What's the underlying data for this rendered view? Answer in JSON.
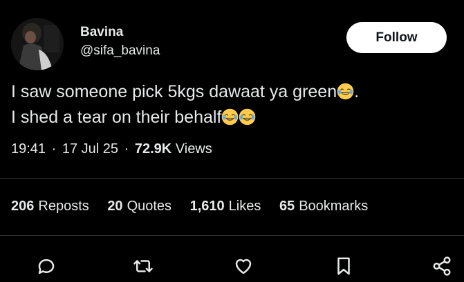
{
  "author": {
    "display_name": "Bavina",
    "handle": "@sifa_bavina"
  },
  "follow_button": {
    "label": "Follow"
  },
  "tweet": {
    "line1": "I saw someone pick 5kgs dawaat ya green",
    "line1_end": ".",
    "line2": "I shed a tear on their behalf",
    "emoji": "face-with-tears-of-joy"
  },
  "meta": {
    "time": "19:41",
    "separator": "·",
    "date": "17 Jul 25",
    "views_count": "72.9K",
    "views_label": "Views"
  },
  "stats": {
    "reposts": {
      "count": "206",
      "label": "Reposts"
    },
    "quotes": {
      "count": "20",
      "label": "Quotes"
    },
    "likes": {
      "count": "1,610",
      "label": "Likes"
    },
    "bookmarks": {
      "count": "65",
      "label": "Bookmarks"
    }
  },
  "actions": [
    "reply-icon",
    "repost-icon",
    "like-icon",
    "bookmark-icon",
    "share-icon"
  ],
  "colors": {
    "background": "#000000",
    "text": "#e7e9ea",
    "divider": "#2f3336",
    "follow_bg": "#ffffff",
    "follow_text": "#0f1419"
  }
}
